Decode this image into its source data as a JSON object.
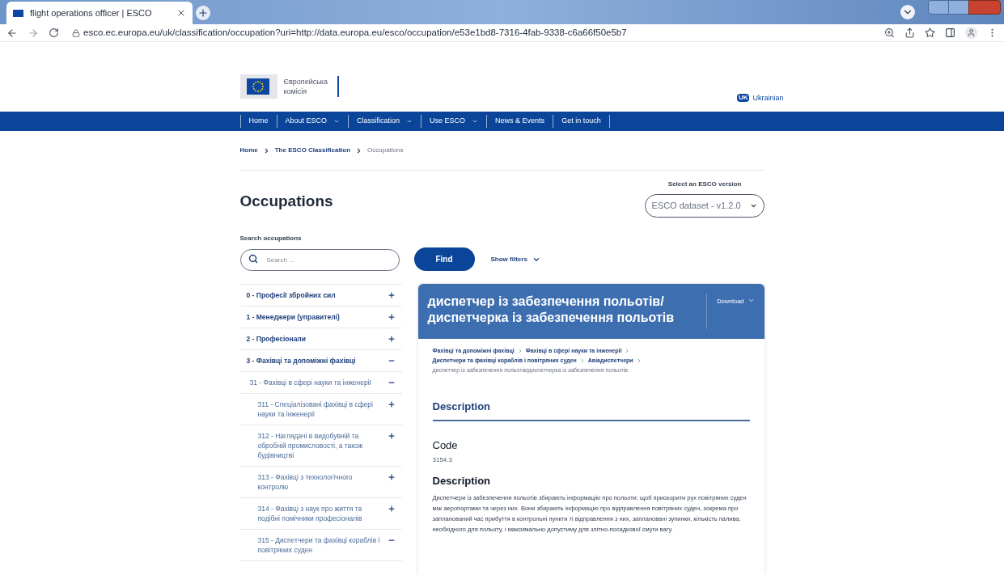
{
  "browser": {
    "tab_title": "flight operations officer | ESCO",
    "url": "esco.ec.europa.eu/uk/classification/occupation?uri=http://data.europa.eu/esco/occupation/e53e1bd8-7316-4fab-9338-c6a66f50e5b7"
  },
  "header": {
    "logo_text": "Європейська комісія",
    "language_code": "UK",
    "language": "Ukrainian"
  },
  "nav": [
    {
      "label": "Home",
      "has_menu": false
    },
    {
      "label": "About ESCO",
      "has_menu": true
    },
    {
      "label": "Classification",
      "has_menu": true
    },
    {
      "label": "Use ESCO",
      "has_menu": true
    },
    {
      "label": "News & Events",
      "has_menu": false
    },
    {
      "label": "Get in touch",
      "has_menu": false
    }
  ],
  "breadcrumb": [
    {
      "label": "Home",
      "current": false
    },
    {
      "label": "The ESCO Classification",
      "current": false
    },
    {
      "label": "Occupations",
      "current": true
    }
  ],
  "page_title": "Occupations",
  "version": {
    "label": "Select an ESCO version",
    "value": "ESCO dataset - v1.2.0"
  },
  "search": {
    "label": "Search occupations",
    "placeholder": "Search ...",
    "button": "Find",
    "filters": "Show filters"
  },
  "tree": [
    {
      "label": "0 - Професії збройних сил",
      "expanded": false
    },
    {
      "label": "1 - Менеджери (управителі)",
      "expanded": false
    },
    {
      "label": "2 - Професіонали",
      "expanded": false
    },
    {
      "label": "3 - Фахівці та допоміжні фахівці",
      "expanded": true,
      "children": [
        {
          "label": "31 - Фахівці в сфері науки та інженерії",
          "expanded": true,
          "children": [
            {
              "label": "311 - Спеціалізовані фахівці в сфері науки та інженерії",
              "expanded": false
            },
            {
              "label": "312 - Наглядачі в видобувній та обробній промисловості, а також будівництві",
              "expanded": false
            },
            {
              "label": "313 - Фахівці з технологічного контролю",
              "expanded": false
            },
            {
              "label": "314 - Фахівці з наук про життя та подібні помічники професіоналів",
              "expanded": false
            },
            {
              "label": "315 - Диспетчери та фахівці кораблів і повітряних суден",
              "expanded": true
            }
          ]
        }
      ]
    }
  ],
  "card": {
    "title": "диспетчер із забезпечення польотів/ диспетчерка із забезпечення польотів",
    "download": "Download",
    "path": [
      {
        "label": "Фахівці та допоміжні фахівці",
        "current": false
      },
      {
        "label": "Фахівці в сфері науки та інженерії",
        "current": false
      },
      {
        "label": "Диспетчери та фахівці кораблів і повітряних суден",
        "current": false
      },
      {
        "label": "Авіадиспетчери",
        "current": false
      },
      {
        "label": "диспетчер із забезпечення польотів/диспетчерка із забезпечення польотів",
        "current": true
      }
    ],
    "section": "Description",
    "code_label": "Code",
    "code": "3154.3",
    "description_label": "Description",
    "description": "Диспетчери із забезпечення польотів збирають інформацію про польоти, щоб прискорити рух повітряних суден між аеропортами та через них. Вони збирають інформацію про відправлення повітряних суден, зокрема про запланований час прибуття в контрольні пункти ті відправлення з них, заплановані зупинки, кількість палива, необхідного для польоту, і максимально допустиму для злітно-посадкової смуги вагу."
  }
}
